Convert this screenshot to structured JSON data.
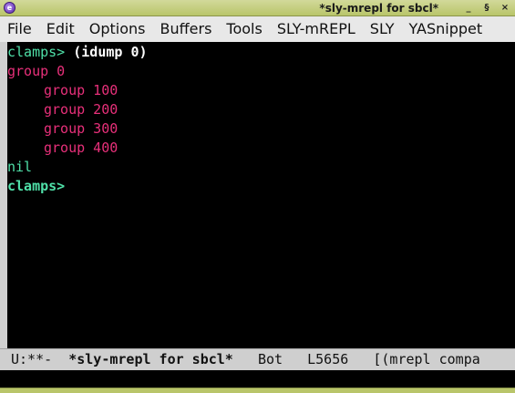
{
  "window": {
    "title": "*sly-mrepl for sbcl*",
    "app_icon": "emacs-icon",
    "controls": {
      "minimize": "_",
      "maximize": "§",
      "close": "×"
    }
  },
  "menu": {
    "items": [
      "File",
      "Edit",
      "Options",
      "Buffers",
      "Tools",
      "SLY-mREPL",
      "SLY",
      "YASnippet"
    ]
  },
  "repl": {
    "prompt1": "clamps>",
    "command": "(idump 0)",
    "out_group0": "group 0",
    "out_group100": "group 100",
    "out_group200": "group 200",
    "out_group300": "group 300",
    "out_group400": "group 400",
    "result": "nil",
    "prompt2": "clamps>"
  },
  "modeline": {
    "status": "U:**-",
    "buffer": "*sly-mrepl for sbcl*",
    "position": "Bot",
    "line": "L5656",
    "modes": "[(mrepl compa"
  },
  "colors": {
    "prompt": "#4fe0a8",
    "output": "#e8307a",
    "titlebar": "#b9c56a",
    "background": "#000000"
  }
}
